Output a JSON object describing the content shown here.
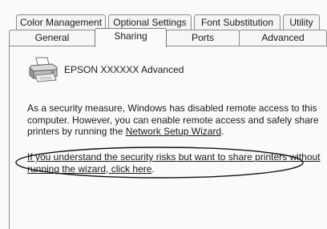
{
  "tabs": {
    "row1": [
      "Color Management",
      "Optional Settings",
      "Font Substitution",
      "Utility"
    ],
    "row2": [
      "General",
      "Sharing",
      "Ports",
      "Advanced"
    ],
    "active": "Sharing"
  },
  "printer": {
    "name": "EPSON XXXXXX Advanced",
    "icon": "printer-icon"
  },
  "content": {
    "paragraph1_line1": "As a security measure, Windows has disabled remote access to this",
    "paragraph1_line2": "computer. However, you can enable remote access and safely share",
    "paragraph1_line3_prefix": "printers by running the ",
    "wizard_link": "Network Setup Wizard",
    "paragraph1_line3_suffix": ".",
    "risk_link_line1": "If you understand the security risks but want to share printers without",
    "risk_link_line2": "running the wizard, click here",
    "risk_link_suffix": "."
  }
}
